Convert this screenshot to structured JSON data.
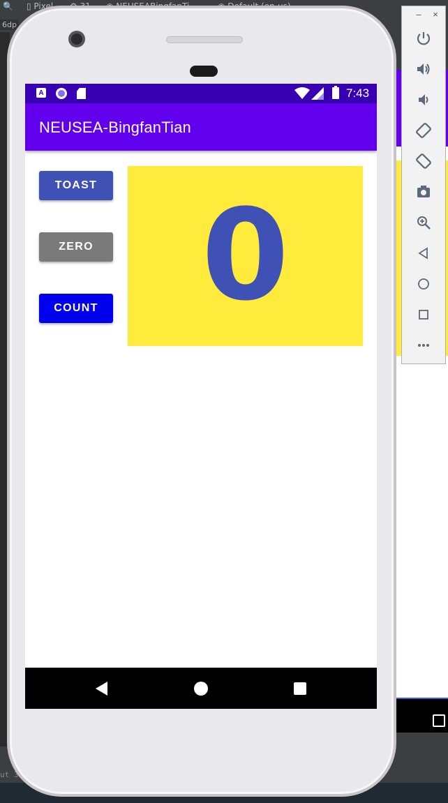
{
  "ide": {
    "device_tab": "Pixel",
    "api_tab": "31",
    "module_tab": "NEUSEABingfanTi...",
    "theme_tab": "Default (en-us)",
    "dp_label": "6dp",
    "bottom_text": "ut  3"
  },
  "status_bar": {
    "time": "7:43",
    "notification_icons": [
      "a-icon",
      "circle-icon",
      "sd-card-icon"
    ],
    "system_icons": [
      "wifi-icon",
      "signal-icon",
      "battery-icon"
    ]
  },
  "app_bar": {
    "title": "NEUSEA-BingfanTian"
  },
  "buttons": {
    "toast_label": "TOAST",
    "zero_label": "ZERO",
    "count_label": "COUNT"
  },
  "counter": {
    "value": "0"
  },
  "nav_bar": {
    "icons": [
      "back-icon",
      "home-icon",
      "recents-icon"
    ]
  },
  "emulator_toolbar": {
    "window_controls": [
      "minimize-icon",
      "close-icon"
    ],
    "minimize_glyph": "–",
    "close_glyph": "×",
    "tools": [
      "power-icon",
      "volume-up-icon",
      "volume-down-icon",
      "rotate-left-icon",
      "rotate-right-icon",
      "screenshot-icon",
      "zoom-icon",
      "back-icon",
      "home-icon",
      "overview-icon",
      "more-icon"
    ]
  },
  "colors": {
    "status_bar": "#3700b3",
    "app_bar": "#6200ee",
    "toast_button": "#3f51b5",
    "zero_button": "#7a7a7a",
    "count_button": "#0000ee",
    "counter_background": "#ffeb3b",
    "counter_text": "#3f51b5"
  }
}
